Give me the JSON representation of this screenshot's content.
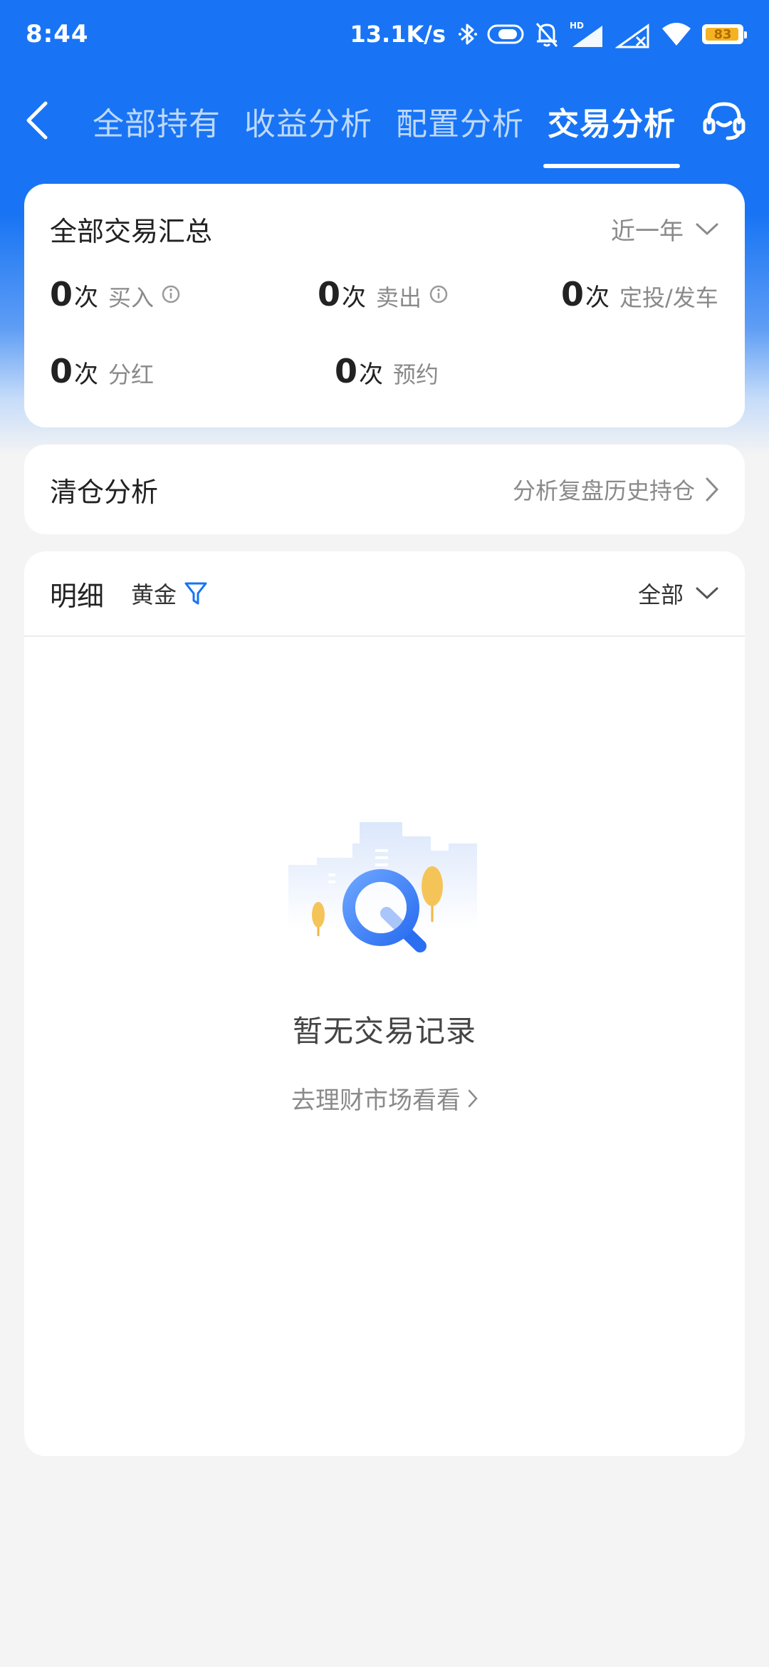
{
  "status_bar": {
    "time": "8:44",
    "net_speed": "13.1K/s",
    "battery": "83",
    "hd_label": "HD"
  },
  "nav": {
    "tabs": [
      {
        "label": "全部持有",
        "active": false
      },
      {
        "label": "收益分析",
        "active": false
      },
      {
        "label": "配置分析",
        "active": false
      },
      {
        "label": "交易分析",
        "active": true
      }
    ]
  },
  "summary": {
    "title": "全部交易汇总",
    "period": "近一年",
    "stats": [
      {
        "num": "0",
        "unit": "次",
        "label": "买入"
      },
      {
        "num": "0",
        "unit": "次",
        "label": "卖出"
      },
      {
        "num": "0",
        "unit": "次",
        "label": "定投/发车"
      },
      {
        "num": "0",
        "unit": "次",
        "label": "分红"
      },
      {
        "num": "0",
        "unit": "次",
        "label": "预约"
      }
    ]
  },
  "clearance": {
    "title": "清仓分析",
    "link": "分析复盘历史持仓"
  },
  "detail": {
    "title": "明细",
    "filter": "黄金",
    "type_select": "全部",
    "empty_text": "暂无交易记录",
    "empty_link": "去理财市场看看"
  },
  "colors": {
    "brand": "#1874f4",
    "accent_yellow": "#f5b324"
  }
}
